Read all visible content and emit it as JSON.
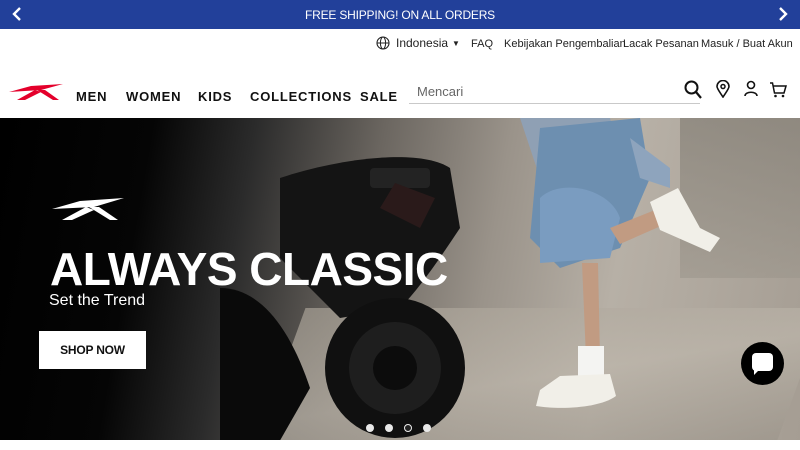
{
  "promo": {
    "message": "FREE SHIPPING! ON ALL ORDERS",
    "prev_icon": "chevron-left-icon",
    "next_icon": "chevron-right-icon"
  },
  "utility": {
    "language": "Indonesia",
    "faq": "FAQ",
    "returns": "Kebijakan Pengembalian",
    "track": "Lacak Pesanan",
    "login": "Masuk / Buat Akun"
  },
  "nav": {
    "items": [
      "MEN",
      "WOMEN",
      "KIDS",
      "COLLECTIONS",
      "SALE"
    ],
    "search_placeholder": "Mencari",
    "brand_color": "#e4002b"
  },
  "hero": {
    "title": "ALWAYS CLASSIC",
    "subtitle": "Set the Trend",
    "cta": "SHOP NOW",
    "slide_count": 4,
    "active_slide": 3
  },
  "colors": {
    "promo_bg": "#22409a",
    "text": "#111111"
  }
}
